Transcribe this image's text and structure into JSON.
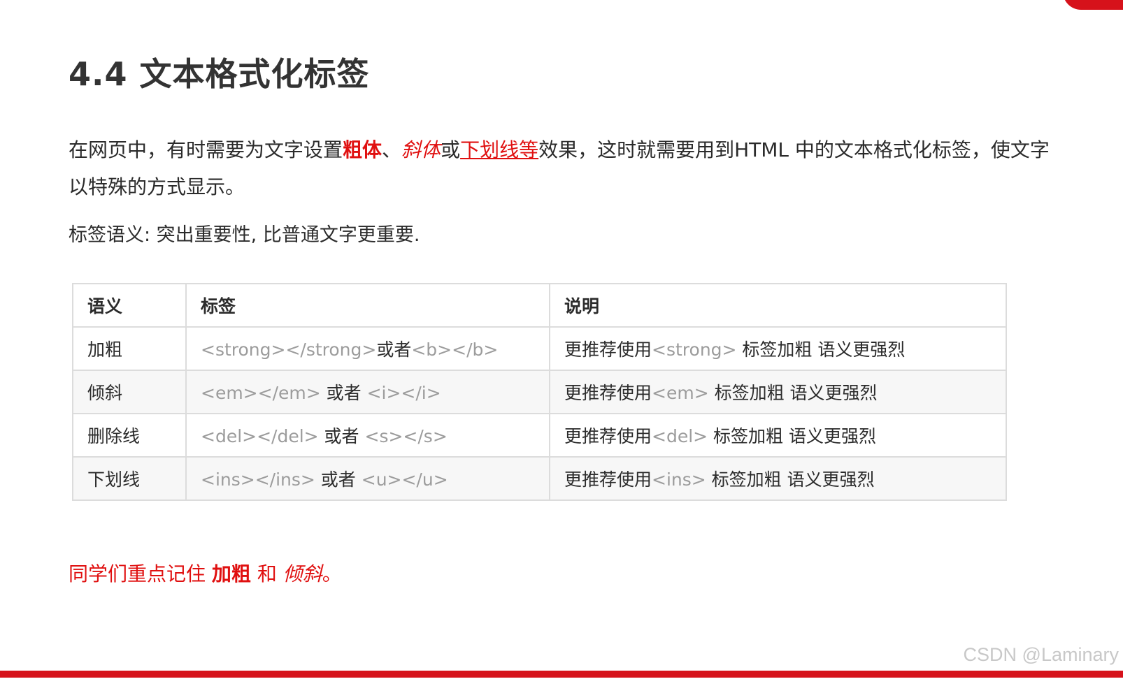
{
  "title": "4.4 文本格式化标签",
  "intro": {
    "part1": "在网页中，有时需要为文字设置",
    "bold": "粗体",
    "sep1": "、",
    "italic": "斜体",
    "sep2": "或",
    "underline": "下划线等",
    "part2": "效果，这时就需要用到HTML 中的文本格式化标签，使文字以特殊的方式显示。"
  },
  "semantic_text": "标签语义: 突出重要性, 比普通文字更重要.",
  "table": {
    "headers": [
      "语义",
      "标签",
      "说明"
    ],
    "rows": [
      {
        "semantic": "加粗",
        "tag_a": "<strong></strong>",
        "or": "或者",
        "tag_b": "<b></b>",
        "desc_prefix": "更推荐使用",
        "desc_tag": "<strong>",
        "desc_suffix": " 标签加粗 语义更强烈"
      },
      {
        "semantic": "倾斜",
        "tag_a": "<em></em>",
        "or": " 或者 ",
        "tag_b": "<i></i>",
        "desc_prefix": "更推荐使用",
        "desc_tag": "<em>",
        "desc_suffix": " 标签加粗 语义更强烈"
      },
      {
        "semantic": "删除线",
        "tag_a": "<del></del>",
        "or": " 或者 ",
        "tag_b": "<s></s>",
        "desc_prefix": "更推荐使用",
        "desc_tag": "<del>",
        "desc_suffix": " 标签加粗 语义更强烈"
      },
      {
        "semantic": "下划线",
        "tag_a": "<ins></ins>",
        "or": " 或者 ",
        "tag_b": "<u></u>",
        "desc_prefix": "更推荐使用",
        "desc_tag": "<ins>",
        "desc_suffix": " 标签加粗 语义更强烈"
      }
    ]
  },
  "footer_note": {
    "prefix": "同学们重点记住 ",
    "bold": "加粗",
    "middle": " 和 ",
    "italic": "倾斜",
    "suffix": "。"
  },
  "watermark": "CSDN @Laminary",
  "colors": {
    "accent": "#d6121b",
    "emphasis_text": "#e01010",
    "code_text": "#9c9c9c"
  }
}
